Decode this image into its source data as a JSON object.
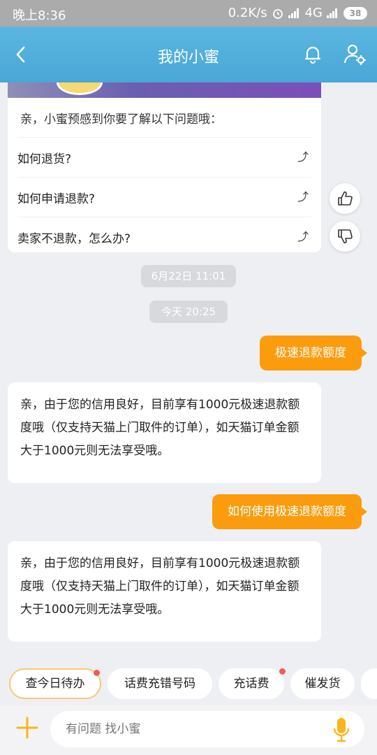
{
  "status": {
    "time": "晚上8:36",
    "speed": "0.2K/s",
    "network": "4G",
    "battery": "38"
  },
  "header": {
    "title": "我的小蜜"
  },
  "faq": {
    "intro": "亲，小蜜预感到你要了解以下问题哦：",
    "items": [
      {
        "label": "如何退货?"
      },
      {
        "label": "如何申请退款?"
      },
      {
        "label": "卖家不退款，怎么办?"
      }
    ],
    "arrow": "⤴"
  },
  "timestamps": [
    "6月22日 11:01",
    "今天 20:25"
  ],
  "messages": [
    {
      "from": "user",
      "text": "极速退款额度"
    },
    {
      "from": "bot",
      "text": "亲，由于您的信用良好，目前享有1000元极速退款额度哦（仅支持天猫上门取件的订单），如天猫订单金额大于1000元则无法享受哦。"
    },
    {
      "from": "user",
      "text": "如何使用极速退款额度"
    },
    {
      "from": "bot",
      "text": "亲，由于您的信用良好，目前享有1000元极速退款额度哦（仅支持天猫上门取件的订单），如天猫订单金额大于1000元则无法享受哦。"
    }
  ],
  "quick_replies": [
    {
      "label": "查今日待办"
    },
    {
      "label": "话费充错号码"
    },
    {
      "label": "充话费"
    },
    {
      "label": "催发货"
    }
  ],
  "input": {
    "placeholder": "有问题 找小蜜"
  },
  "colors": {
    "header": "#4aa7d6",
    "user_bubble": "#fa9c0e",
    "accent_mic": "#f9b51a",
    "badge": "#f25b5b"
  },
  "icons": {
    "back": "chevron-left-icon",
    "bell": "bell-icon",
    "settings": "user-settings-icon",
    "like": "thumbs-up-icon",
    "dislike": "thumbs-down-icon",
    "plus": "plus-icon",
    "mic": "microphone-icon"
  }
}
